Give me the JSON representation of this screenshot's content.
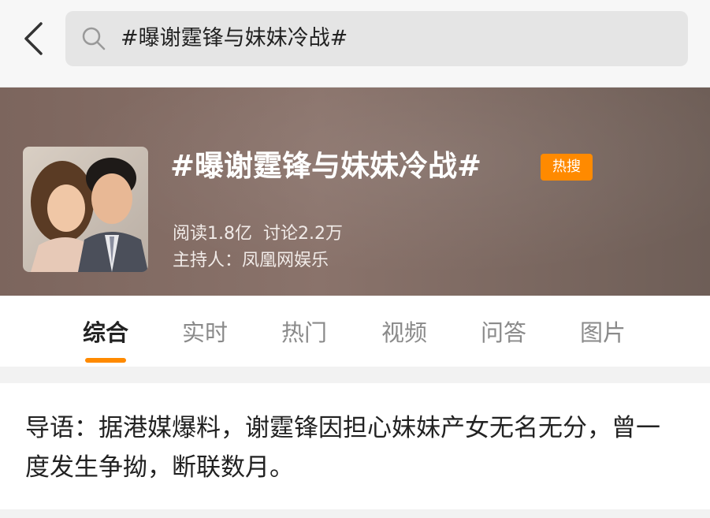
{
  "header": {
    "back_icon": "chevron-left-icon",
    "search_icon": "search-icon",
    "search_query": "#曝谢霆锋与妹妹冷战#"
  },
  "topic": {
    "title": "#曝谢霆锋与妹妹冷战#",
    "badge": "热搜",
    "reads": "阅读1.8亿",
    "discussions": "讨论2.2万",
    "host": "主持人：凤凰网娱乐",
    "accent_color": "#ff8a00"
  },
  "tabs": [
    {
      "label": "综合",
      "active": true
    },
    {
      "label": "实时",
      "active": false
    },
    {
      "label": "热门",
      "active": false
    },
    {
      "label": "视频",
      "active": false
    },
    {
      "label": "问答",
      "active": false
    },
    {
      "label": "图片",
      "active": false
    }
  ],
  "intro": {
    "text": "导语：据港媒爆料，谢霆锋因担心妹妹产女无名无分，曾一度发生争拗，断联数月。"
  }
}
